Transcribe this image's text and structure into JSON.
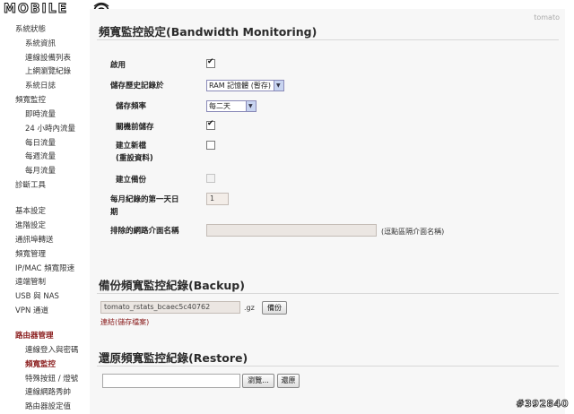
{
  "logo": {
    "text": "MOBILE"
  },
  "corner_label": "tomato",
  "watermark": "#392840",
  "sidebar": {
    "items": [
      {
        "label": "系統狀態",
        "level": "top"
      },
      {
        "label": "系統資訊",
        "level": "sub"
      },
      {
        "label": "連線設備列表",
        "level": "sub"
      },
      {
        "label": "上網瀏覽紀錄",
        "level": "sub"
      },
      {
        "label": "系統日誌",
        "level": "sub"
      },
      {
        "label": "頻寬監控",
        "level": "top"
      },
      {
        "label": "即時流量",
        "level": "sub"
      },
      {
        "label": "24 小時內流量",
        "level": "sub"
      },
      {
        "label": "每日流量",
        "level": "sub"
      },
      {
        "label": "每週流量",
        "level": "sub"
      },
      {
        "label": "每月流量",
        "level": "sub"
      },
      {
        "label": "診斷工具",
        "level": "top"
      },
      {
        "label": "基本設定",
        "level": "top"
      },
      {
        "label": "進階設定",
        "level": "top"
      },
      {
        "label": "通訊埠轉送",
        "level": "top"
      },
      {
        "label": "頻寬管理",
        "level": "top"
      },
      {
        "label": "IP/MAC 頻寬限速",
        "level": "top"
      },
      {
        "label": "遠端管制",
        "level": "top"
      },
      {
        "label": "USB 與 NAS",
        "level": "top"
      },
      {
        "label": "VPN 通道",
        "level": "top"
      },
      {
        "label": "路由器管理",
        "level": "section"
      },
      {
        "label": "連線登入與密碼",
        "level": "sub"
      },
      {
        "label": "頻寬監控",
        "level": "active"
      },
      {
        "label": "特殊按鈕 / 燈號",
        "level": "sub"
      },
      {
        "label": "連線網路秀帥",
        "level": "sub"
      },
      {
        "label": "路由器設定值",
        "level": "sub"
      }
    ]
  },
  "monitoring": {
    "title": "頻寬監控設定(Bandwidth Monitoring)",
    "enable_label": "啟用",
    "enable_checked": true,
    "save_history_label": "儲存歷史記錄於",
    "save_history_value": "RAM 記憶體 (暫存)",
    "save_freq_label": "儲存頻率",
    "save_freq_value": "每二天",
    "save_on_shutdown_label": "關機前儲存",
    "save_on_shutdown_checked": true,
    "create_new_label_1": "建立新檔",
    "create_new_label_2": "(重設資料)",
    "create_new_checked": false,
    "create_backup_label": "建立備份",
    "create_backup_checked": false,
    "first_day_label_1": "每月紀錄的第一天日",
    "first_day_label_2": "期",
    "first_day_value": "1",
    "exclude_label": "排除的網路介面名稱",
    "exclude_value": "",
    "exclude_note": "(逗點區隔介面名稱)"
  },
  "backup": {
    "title": "備份頻寬監控紀錄(Backup)",
    "filename": "tomato_rstats_bcaec5c40762",
    "ext": ".gz",
    "button": "備份",
    "link": "連結(儲存檔案)"
  },
  "restore": {
    "title": "還原頻寬監控紀錄(Restore)",
    "file_value": "",
    "browse_button": "瀏覽...",
    "restore_button": "還原"
  }
}
